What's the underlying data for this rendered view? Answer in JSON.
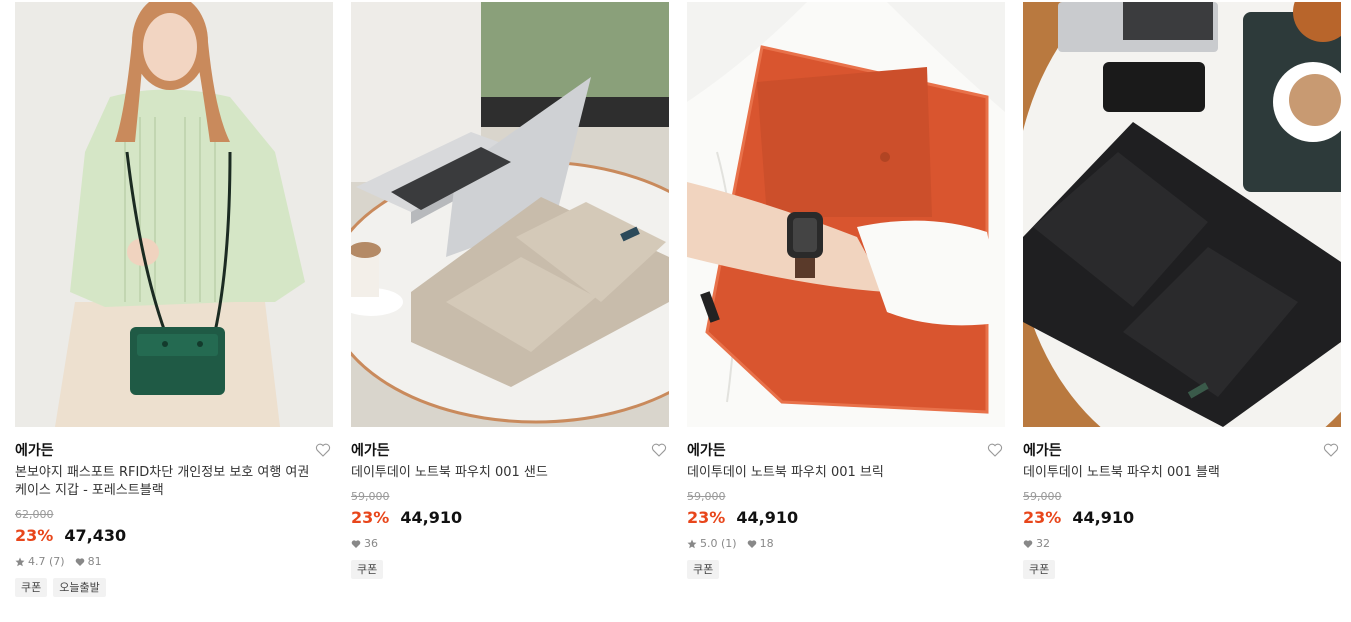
{
  "products": [
    {
      "brand": "에가든",
      "title": "본보야지 패스포트 RFID차단 개인정보 보호 여행 여권 케이스 지갑 - 포레스트블랙",
      "original_price": "62,000",
      "discount": "23%",
      "price": "47,430",
      "rating": "4.7 (7)",
      "likes": "81",
      "tags": [
        "쿠폰",
        "오늘출발"
      ],
      "image": "woman-with-green-crossbody-wallet"
    },
    {
      "brand": "에가든",
      "title": "데이투데이 노트북 파우치 001 샌드",
      "original_price": "59,000",
      "discount": "23%",
      "price": "44,910",
      "rating": "",
      "likes": "36",
      "tags": [
        "쿠폰"
      ],
      "image": "sand-laptop-pouch-on-table"
    },
    {
      "brand": "에가든",
      "title": "데이투데이 노트북 파우치 001 브릭",
      "original_price": "59,000",
      "discount": "23%",
      "price": "44,910",
      "rating": "5.0 (1)",
      "likes": "18",
      "tags": [
        "쿠폰"
      ],
      "image": "brick-laptop-pouch-held"
    },
    {
      "brand": "에가든",
      "title": "데이투데이 노트북 파우치 001 블랙",
      "original_price": "59,000",
      "discount": "23%",
      "price": "44,910",
      "rating": "",
      "likes": "32",
      "tags": [
        "쿠폰"
      ],
      "image": "black-laptop-pouch-on-table"
    }
  ],
  "colors": {
    "discount": "#e8461b",
    "price": "#111111",
    "muted": "#9a9a9a",
    "tag_bg": "#f2f2f2"
  },
  "icons": {
    "wish": "heart-outline-icon",
    "rating": "star-icon",
    "likes": "heart-filled-icon"
  }
}
